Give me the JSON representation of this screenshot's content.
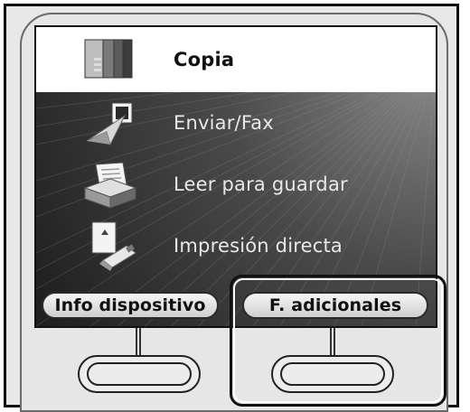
{
  "menu": {
    "items": [
      {
        "label": "Copia",
        "icon": "copy-icon",
        "selected": true
      },
      {
        "label": "Enviar/Fax",
        "icon": "send-fax-icon",
        "selected": false
      },
      {
        "label": "Leer para guardar",
        "icon": "scan-to-save-icon",
        "selected": false
      },
      {
        "label": "Impresión directa",
        "icon": "direct-print-icon",
        "selected": false
      }
    ]
  },
  "softkeys": {
    "left": "Info dispositivo",
    "right": "F. adicionales"
  },
  "colors": {
    "screen_bg": "#2a2a2a",
    "selected_bg": "#ffffff",
    "softkey_bg": "#e2e2e2",
    "text_light": "#e8e8e8",
    "text_dark": "#111111"
  }
}
